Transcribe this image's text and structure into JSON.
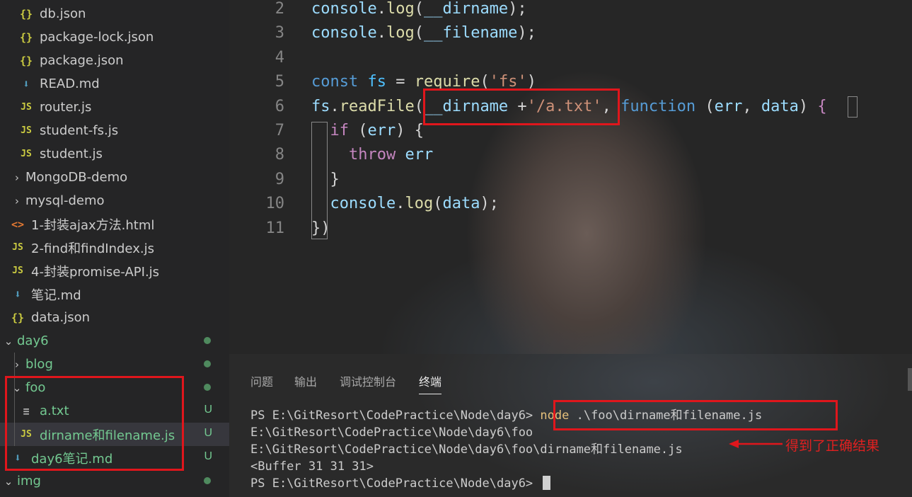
{
  "explorer": {
    "items": [
      {
        "label": "db.json",
        "icon": "json-braces-icon",
        "glyph": "{}"
      },
      {
        "label": "package-lock.json",
        "icon": "json-braces-icon",
        "glyph": "{}"
      },
      {
        "label": "package.json",
        "icon": "json-braces-icon",
        "glyph": "{}"
      },
      {
        "label": "READ.md",
        "icon": "markdown-arrow-icon",
        "glyph": "⬇"
      },
      {
        "label": "router.js",
        "icon": "javascript-icon",
        "glyph": "JS"
      },
      {
        "label": "student-fs.js",
        "icon": "javascript-icon",
        "glyph": "JS"
      },
      {
        "label": "student.js",
        "icon": "javascript-icon",
        "glyph": "JS"
      },
      {
        "label": "MongoDB-demo",
        "icon": "chevron-right-icon",
        "glyph": "›"
      },
      {
        "label": "mysql-demo",
        "icon": "chevron-right-icon",
        "glyph": "›"
      },
      {
        "label": "1-封装ajax方法.html",
        "icon": "html-icon",
        "glyph": "<>"
      },
      {
        "label": "2-find和findIndex.js",
        "icon": "javascript-icon",
        "glyph": "JS"
      },
      {
        "label": "4-封装promise-API.js",
        "icon": "javascript-icon",
        "glyph": "JS"
      },
      {
        "label": "笔记.md",
        "icon": "markdown-arrow-icon",
        "glyph": "⬇"
      },
      {
        "label": "data.json",
        "icon": "json-braces-icon",
        "glyph": "{}"
      },
      {
        "label": "day6",
        "icon": "chevron-down-icon",
        "glyph": "⌄"
      },
      {
        "label": "blog",
        "icon": "chevron-right-icon",
        "glyph": "›"
      },
      {
        "label": "foo",
        "icon": "chevron-down-icon",
        "glyph": "⌄"
      },
      {
        "label": "a.txt",
        "icon": "text-lines-icon",
        "glyph": "≡",
        "badge": "U"
      },
      {
        "label": "dirname和filename.js",
        "icon": "javascript-icon",
        "glyph": "JS",
        "badge": "U"
      },
      {
        "label": "day6笔记.md",
        "icon": "markdown-arrow-icon",
        "glyph": "⬇",
        "badge": "U"
      },
      {
        "label": "img",
        "icon": "chevron-down-icon",
        "glyph": "⌄"
      }
    ]
  },
  "editor": {
    "line_numbers": [
      "2",
      "3",
      "4",
      "5",
      "6",
      "7",
      "8",
      "9",
      "10",
      "11"
    ],
    "lines": [
      [
        {
          "t": "console",
          "c": "var"
        },
        {
          "t": ".",
          "c": ""
        },
        {
          "t": "log",
          "c": "fn"
        },
        {
          "t": "(",
          "c": ""
        },
        {
          "t": "__dirname",
          "c": "var"
        },
        {
          "t": ");",
          "c": ""
        }
      ],
      [
        {
          "t": "console",
          "c": "var"
        },
        {
          "t": ".",
          "c": ""
        },
        {
          "t": "log",
          "c": "fn"
        },
        {
          "t": "(",
          "c": ""
        },
        {
          "t": "__filename",
          "c": "var"
        },
        {
          "t": ");",
          "c": ""
        }
      ],
      [],
      [
        {
          "t": "const",
          "c": "blue"
        },
        {
          "t": " ",
          "c": ""
        },
        {
          "t": "fs",
          "c": "const"
        },
        {
          "t": " = ",
          "c": ""
        },
        {
          "t": "require",
          "c": "fn"
        },
        {
          "t": "(",
          "c": ""
        },
        {
          "t": "'fs'",
          "c": "str"
        },
        {
          "t": ")",
          "c": ""
        }
      ],
      [
        {
          "t": "fs",
          "c": "var"
        },
        {
          "t": ".",
          "c": ""
        },
        {
          "t": "readFile",
          "c": "fn"
        },
        {
          "t": "(",
          "c": ""
        },
        {
          "t": "__dirname",
          "c": "var"
        },
        {
          "t": " +",
          "c": ""
        },
        {
          "t": "'/a.txt'",
          "c": "str"
        },
        {
          "t": ", ",
          "c": ""
        },
        {
          "t": "function",
          "c": "blue"
        },
        {
          "t": " (",
          "c": ""
        },
        {
          "t": "err",
          "c": "var"
        },
        {
          "t": ", ",
          "c": ""
        },
        {
          "t": "data",
          "c": "var"
        },
        {
          "t": ") ",
          "c": ""
        },
        {
          "t": "{",
          "c": "purple"
        }
      ],
      [
        {
          "t": "  ",
          "c": ""
        },
        {
          "t": "if",
          "c": "purple"
        },
        {
          "t": " (",
          "c": ""
        },
        {
          "t": "err",
          "c": "var"
        },
        {
          "t": ") {",
          "c": ""
        }
      ],
      [
        {
          "t": "    ",
          "c": ""
        },
        {
          "t": "throw",
          "c": "purple"
        },
        {
          "t": " ",
          "c": ""
        },
        {
          "t": "err",
          "c": "var"
        }
      ],
      [
        {
          "t": "  }",
          "c": ""
        }
      ],
      [
        {
          "t": "  ",
          "c": ""
        },
        {
          "t": "console",
          "c": "var"
        },
        {
          "t": ".",
          "c": ""
        },
        {
          "t": "log",
          "c": "fn"
        },
        {
          "t": "(",
          "c": ""
        },
        {
          "t": "data",
          "c": "var"
        },
        {
          "t": ");",
          "c": ""
        }
      ],
      [
        {
          "t": "})",
          "c": ""
        }
      ]
    ]
  },
  "panel": {
    "tabs": [
      "问题",
      "输出",
      "调试控制台",
      "终端"
    ],
    "active_tab": "终端",
    "terminal": {
      "line1_prompt": "PS E:\\GitResort\\CodePractice\\Node\\day6> ",
      "line1_cmd_keyword": "node",
      "line1_cmd_rest": " .\\foo\\dirname和filename.js",
      "line2": "E:\\GitResort\\CodePractice\\Node\\day6\\foo",
      "line3": "E:\\GitResort\\CodePractice\\Node\\day6\\foo\\dirname和filename.js",
      "line4": "<Buffer 31 31 31>",
      "line5_prompt": "PS E:\\GitResort\\CodePractice\\Node\\day6> "
    },
    "annotation": "得到了正确结果"
  },
  "colors": {
    "highlight_box": "#e0161c",
    "untracked": "#73c991"
  }
}
